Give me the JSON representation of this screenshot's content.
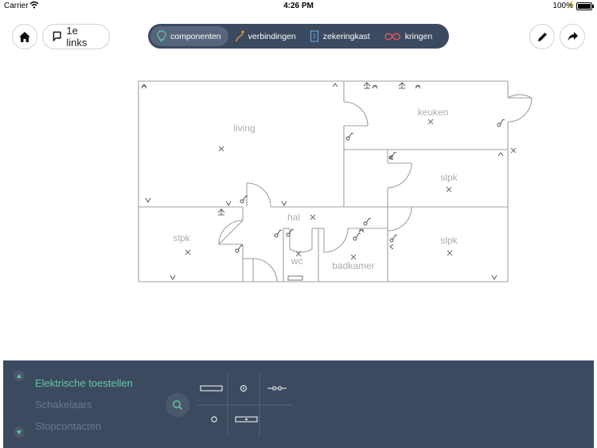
{
  "status": {
    "carrier": "Carrier",
    "time": "4:26 PM",
    "battery": "100%"
  },
  "toolbar": {
    "links_label": "1e links"
  },
  "segments": [
    {
      "label": "componenten",
      "icon": "bulb-icon"
    },
    {
      "label": "verbindingen",
      "icon": "wire-icon"
    },
    {
      "label": "zekeringkast",
      "icon": "fusebox-icon"
    },
    {
      "label": "kringen",
      "icon": "infinity-icon"
    }
  ],
  "rooms": {
    "living": "living",
    "keuken": "keuken",
    "slpk_right_top": "slpk",
    "slpk_left": "slpk",
    "slpk_right_bottom": "slpk",
    "hal": "hal",
    "wc": "wc",
    "badkamer": "badkamer"
  },
  "panel": {
    "categories": [
      "Elektrische toestellen",
      "Schakelaars",
      "Stopcontacten"
    ],
    "active_category": "Elektrische toestellen"
  },
  "colors": {
    "panel_bg": "#3b4a5f",
    "active_green": "#63c7a0",
    "segment_active": "#56657a",
    "kringen_red": "#e05a5a",
    "verbindingen_orange": "#e89a3c",
    "bulb_green": "#63c7a0",
    "zekering_blue": "#6aa6d8"
  }
}
